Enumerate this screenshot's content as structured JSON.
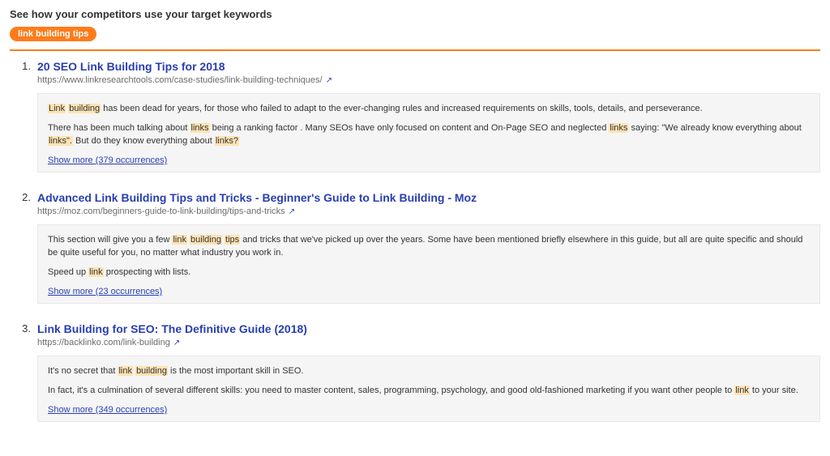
{
  "section_title": "See how your competitors use your target keywords",
  "keyword_pill": "link building tips",
  "results": [
    {
      "rank": "1.",
      "title": "20 SEO Link Building Tips for 2018",
      "url": "https://www.linkresearchtools.com/case-studies/link-building-techniques/",
      "paragraphs": [
        [
          {
            "t": "Link",
            "h": true
          },
          {
            "t": " ",
            "h": false
          },
          {
            "t": "building",
            "h": true
          },
          {
            "t": " has been dead for years, for those who failed to adapt to the ever-changing rules and increased requirements on skills, tools, details, and perseverance.",
            "h": false
          }
        ],
        [
          {
            "t": "There has been much talking about ",
            "h": false
          },
          {
            "t": "links",
            "h": true
          },
          {
            "t": " being a ranking factor . Many SEOs have only focused on content and On-Page SEO and neglected ",
            "h": false
          },
          {
            "t": "links",
            "h": true
          },
          {
            "t": " saying: \"We already know everything about ",
            "h": false
          },
          {
            "t": "links\".",
            "h": true
          },
          {
            "t": " But do they know everything about ",
            "h": false
          },
          {
            "t": "links?",
            "h": true
          }
        ]
      ],
      "show_more": "Show more (379 occurrences)"
    },
    {
      "rank": "2.",
      "title": "Advanced Link Building Tips and Tricks - Beginner's Guide to Link Building - Moz",
      "url": "https://moz.com/beginners-guide-to-link-building/tips-and-tricks",
      "paragraphs": [
        [
          {
            "t": "This section will give you a few ",
            "h": false
          },
          {
            "t": "link",
            "h": true
          },
          {
            "t": " ",
            "h": false
          },
          {
            "t": "building",
            "h": true
          },
          {
            "t": " ",
            "h": false
          },
          {
            "t": "tips",
            "h": true
          },
          {
            "t": " and tricks that we've picked up over the years. Some have been mentioned briefly elsewhere in this guide, but all are quite specific and should be quite useful for you, no matter what industry you work in.",
            "h": false
          }
        ],
        [
          {
            "t": "Speed up ",
            "h": false
          },
          {
            "t": "link",
            "h": true
          },
          {
            "t": " prospecting with lists.",
            "h": false
          }
        ]
      ],
      "show_more": "Show more (23 occurrences)"
    },
    {
      "rank": "3.",
      "title": "Link Building for SEO: The Definitive Guide (2018)",
      "url": "https://backlinko.com/link-building",
      "paragraphs": [
        [
          {
            "t": "It's no secret that ",
            "h": false
          },
          {
            "t": "link",
            "h": true
          },
          {
            "t": " ",
            "h": false
          },
          {
            "t": "building",
            "h": true
          },
          {
            "t": " is the most important skill in SEO.",
            "h": false
          }
        ],
        [
          {
            "t": "In fact, it's a culmination of several different skills: you need to master content, sales, programming, psychology, and good old-fashioned marketing if you want other people to ",
            "h": false
          },
          {
            "t": "link",
            "h": true
          },
          {
            "t": " to your site.",
            "h": false
          }
        ]
      ],
      "show_more": "Show more (349 occurrences)"
    }
  ],
  "ext_icon_glyph": "↗"
}
